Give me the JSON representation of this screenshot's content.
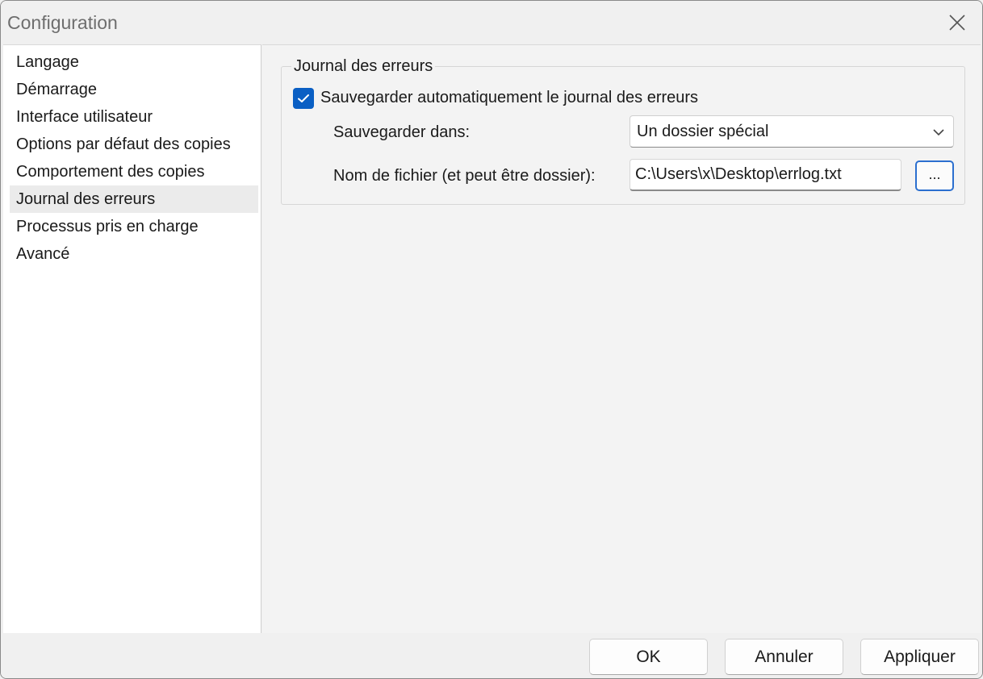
{
  "window": {
    "title": "Configuration",
    "close_icon": "close-icon"
  },
  "sidebar": {
    "items": [
      {
        "label": "Langage",
        "selected": false
      },
      {
        "label": "Démarrage",
        "selected": false
      },
      {
        "label": "Interface utilisateur",
        "selected": false
      },
      {
        "label": "Options par défaut des copies",
        "selected": false
      },
      {
        "label": "Comportement des copies",
        "selected": false
      },
      {
        "label": "Journal des erreurs",
        "selected": true
      },
      {
        "label": "Processus pris en charge",
        "selected": false
      },
      {
        "label": "Avancé",
        "selected": false
      }
    ]
  },
  "error_log": {
    "group_title": "Journal des erreurs",
    "autosave_label": "Sauvegarder automatiquement le journal des erreurs",
    "autosave_checked": true,
    "save_in_label": "Sauvegarder dans:",
    "save_in_value": "Un dossier spécial",
    "filename_label": "Nom de fichier (et peut être dossier):",
    "filename_value": "C:\\Users\\x\\Desktop\\errlog.txt",
    "browse_label": "..."
  },
  "footer": {
    "ok_label": "OK",
    "cancel_label": "Annuler",
    "apply_label": "Appliquer"
  },
  "colors": {
    "accent": "#0a5fc4",
    "selected_item_bg": "#ebebeb"
  }
}
